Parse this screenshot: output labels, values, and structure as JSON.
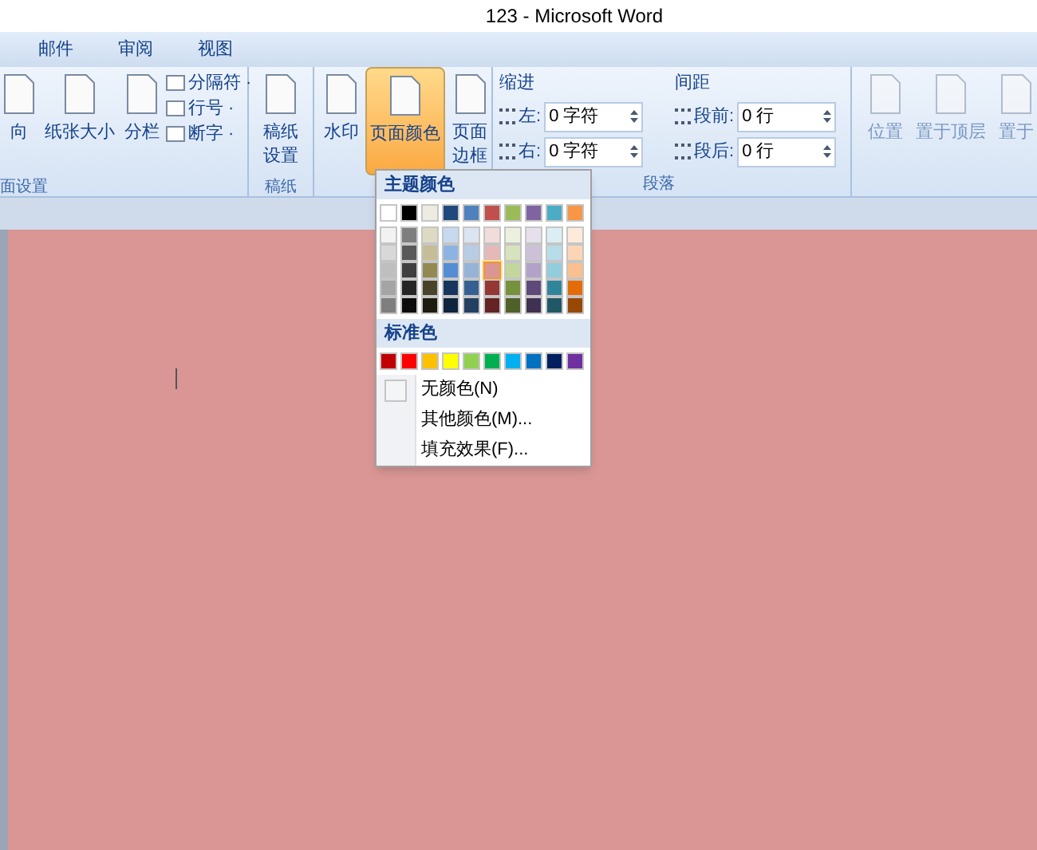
{
  "window": {
    "title": "123 - Microsoft Word"
  },
  "tabs": [
    {
      "label": "邮件",
      "selected": false
    },
    {
      "label": "审阅",
      "selected": false
    },
    {
      "label": "视图",
      "selected": false
    }
  ],
  "ribbon": {
    "groups": [
      {
        "kind": "page_setup",
        "label": "面设置",
        "large": [
          "向",
          "纸张大小",
          "分栏"
        ],
        "small": [
          "分隔符 ·",
          "行号 ·",
          "断字 ·"
        ]
      },
      {
        "kind": "large",
        "label": "稿纸",
        "large": [
          "稿纸设置"
        ]
      },
      {
        "kind": "background",
        "large": [
          {
            "label": "水印",
            "active": false
          },
          {
            "label": "页面颜色",
            "active": true
          },
          {
            "label": "页面边框",
            "active": false
          }
        ]
      },
      {
        "kind": "paragraph",
        "label": "段落",
        "indent_title": "缩进",
        "spacing_title": "间距",
        "fields": [
          {
            "label": "左:",
            "value": "0 字符"
          },
          {
            "label": "右:",
            "value": "0 字符"
          },
          {
            "label": "段前:",
            "value": "0 行"
          },
          {
            "label": "段后:",
            "value": "0 行"
          }
        ]
      },
      {
        "kind": "arrange",
        "large": [
          "位置",
          "置于顶层",
          "置于"
        ]
      }
    ]
  },
  "color_menu": {
    "theme_title": "主题颜色",
    "theme": [
      {
        "color": "#ffffff",
        "selected": false
      },
      {
        "color": "#000000",
        "selected": false
      },
      {
        "color": "#eeece1",
        "selected": false
      },
      {
        "color": "#1f497d",
        "selected": false
      },
      {
        "color": "#4f81bd",
        "selected": false
      },
      {
        "color": "#c0504d",
        "selected": false
      },
      {
        "color": "#9bbb59",
        "selected": false
      },
      {
        "color": "#8064a2",
        "selected": false
      },
      {
        "color": "#4bacc6",
        "selected": false
      },
      {
        "color": "#f79646",
        "selected": false
      }
    ],
    "shades": [
      [
        {
          "color": "#f2f2f2",
          "selected": false
        },
        {
          "color": "#d8d8d8",
          "selected": false
        },
        {
          "color": "#bfbfbf",
          "selected": false
        },
        {
          "color": "#a5a5a5",
          "selected": false
        },
        {
          "color": "#7f7f7f",
          "selected": false
        }
      ],
      [
        {
          "color": "#7f7f7f",
          "selected": false
        },
        {
          "color": "#595959",
          "selected": false
        },
        {
          "color": "#3f3f3f",
          "selected": false
        },
        {
          "color": "#262626",
          "selected": false
        },
        {
          "color": "#0c0c0c",
          "selected": false
        }
      ],
      [
        {
          "color": "#ddd9c3",
          "selected": false
        },
        {
          "color": "#c4bd97",
          "selected": false
        },
        {
          "color": "#938953",
          "selected": false
        },
        {
          "color": "#494429",
          "selected": false
        },
        {
          "color": "#1d1b10",
          "selected": false
        }
      ],
      [
        {
          "color": "#c6d9f0",
          "selected": false
        },
        {
          "color": "#8db3e2",
          "selected": false
        },
        {
          "color": "#548dd4",
          "selected": false
        },
        {
          "color": "#17365d",
          "selected": false
        },
        {
          "color": "#0f243e",
          "selected": false
        }
      ],
      [
        {
          "color": "#dbe5f1",
          "selected": false
        },
        {
          "color": "#b8cce4",
          "selected": false
        },
        {
          "color": "#95b3d7",
          "selected": false
        },
        {
          "color": "#366092",
          "selected": false
        },
        {
          "color": "#244061",
          "selected": false
        }
      ],
      [
        {
          "color": "#f2dcdb",
          "selected": false
        },
        {
          "color": "#e5b9b7",
          "selected": false
        },
        {
          "color": "#d99694",
          "selected": true
        },
        {
          "color": "#953734",
          "selected": false
        },
        {
          "color": "#632423",
          "selected": false
        }
      ],
      [
        {
          "color": "#ebf1dd",
          "selected": false
        },
        {
          "color": "#d7e3bc",
          "selected": false
        },
        {
          "color": "#c3d69b",
          "selected": false
        },
        {
          "color": "#76923c",
          "selected": false
        },
        {
          "color": "#4f6128",
          "selected": false
        }
      ],
      [
        {
          "color": "#e5e0ec",
          "selected": false
        },
        {
          "color": "#ccc1d9",
          "selected": false
        },
        {
          "color": "#b2a2c7",
          "selected": false
        },
        {
          "color": "#5f497a",
          "selected": false
        },
        {
          "color": "#3f3151",
          "selected": false
        }
      ],
      [
        {
          "color": "#dbeef3",
          "selected": false
        },
        {
          "color": "#b7dde8",
          "selected": false
        },
        {
          "color": "#92cddc",
          "selected": false
        },
        {
          "color": "#31859b",
          "selected": false
        },
        {
          "color": "#205867",
          "selected": false
        }
      ],
      [
        {
          "color": "#fdeada",
          "selected": false
        },
        {
          "color": "#fbd5b5",
          "selected": false
        },
        {
          "color": "#fac08f",
          "selected": false
        },
        {
          "color": "#e36c09",
          "selected": false
        },
        {
          "color": "#974806",
          "selected": false
        }
      ]
    ],
    "standard_title": "标准色",
    "standard": [
      {
        "color": "#c00000",
        "selected": false
      },
      {
        "color": "#ff0000",
        "selected": false
      },
      {
        "color": "#ffc000",
        "selected": false
      },
      {
        "color": "#ffff00",
        "selected": false
      },
      {
        "color": "#92d050",
        "selected": false
      },
      {
        "color": "#00b050",
        "selected": false
      },
      {
        "color": "#00b0f0",
        "selected": false
      },
      {
        "color": "#0070c0",
        "selected": false
      },
      {
        "color": "#002060",
        "selected": false
      },
      {
        "color": "#7030a0",
        "selected": false
      }
    ],
    "items": [
      {
        "kind": "no_color",
        "label": "无颜色(N)"
      },
      {
        "kind": "more",
        "label": "其他颜色(M)..."
      },
      {
        "kind": "fill",
        "label": "填充效果(F)..."
      }
    ]
  }
}
